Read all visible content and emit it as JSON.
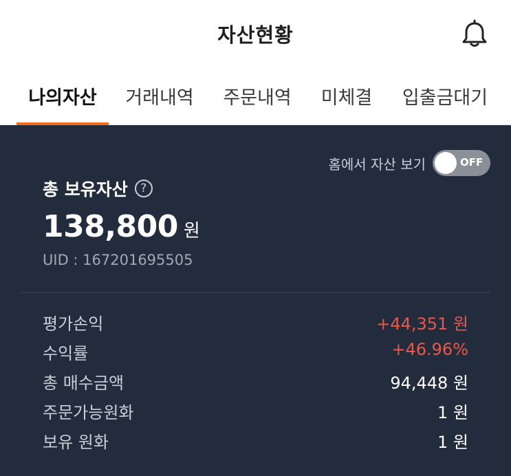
{
  "header": {
    "title": "자산현황",
    "bell_icon": "bell-icon"
  },
  "tabs": [
    {
      "label": "나의자산",
      "active": true
    },
    {
      "label": "거래내역",
      "active": false
    },
    {
      "label": "주문내역",
      "active": false
    },
    {
      "label": "미체결",
      "active": false
    },
    {
      "label": "입출금대기",
      "active": false
    }
  ],
  "colors": {
    "accent": "#ee6b1f",
    "panel_bg": "#222c3d",
    "profit": "#e9584a"
  },
  "panel": {
    "home_toggle_label": "홈에서 자산 보기",
    "toggle_state": "OFF",
    "total_label": "총 보유자산",
    "help_glyph": "?",
    "total_value": "138,800",
    "total_unit": "원",
    "uid": "UID : 167201695505"
  },
  "stats": [
    {
      "label": "평가손익",
      "value": "+44,351 원",
      "highlight": true
    },
    {
      "label": "수익률",
      "value": "+46.96%",
      "highlight": true
    },
    {
      "label": "총 매수금액",
      "value": "94,448 원",
      "highlight": false
    },
    {
      "label": "주문가능원화",
      "value": "1 원",
      "highlight": false
    },
    {
      "label": "보유 원화",
      "value": "1 원",
      "highlight": false
    }
  ]
}
